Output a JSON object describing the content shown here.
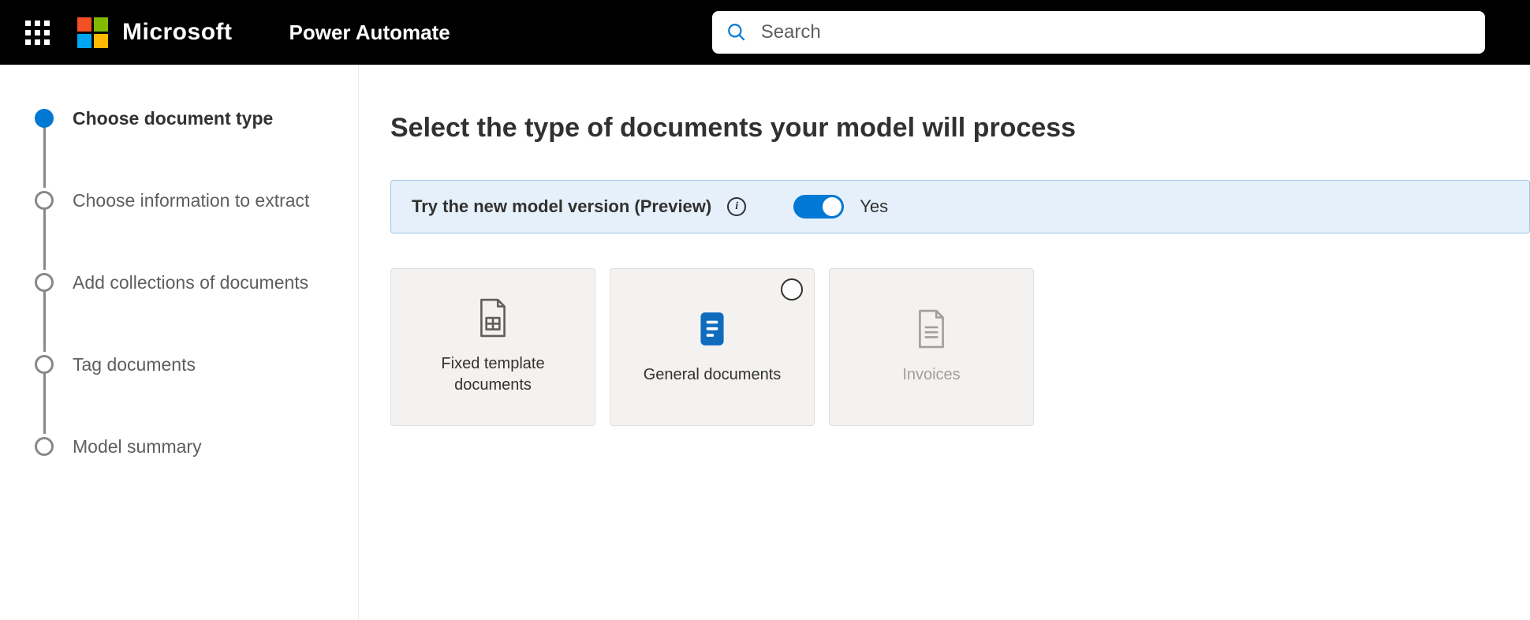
{
  "header": {
    "company": "Microsoft",
    "app": "Power Automate",
    "search_placeholder": "Search"
  },
  "wizard": {
    "steps": [
      {
        "label": "Choose document type",
        "active": true
      },
      {
        "label": "Choose information to extract",
        "active": false
      },
      {
        "label": "Add collections of documents",
        "active": false
      },
      {
        "label": "Tag documents",
        "active": false
      },
      {
        "label": "Model summary",
        "active": false
      }
    ]
  },
  "page": {
    "heading": "Select the type of documents your model will process",
    "banner": {
      "text": "Try the new model version (Preview)",
      "toggle_value": "Yes"
    },
    "cards": [
      {
        "label": "Fixed template documents",
        "icon": "fixed-template",
        "selected": false,
        "showRadio": false
      },
      {
        "label": "General documents",
        "icon": "general",
        "selected": true,
        "showRadio": true
      },
      {
        "label": "Invoices",
        "icon": "invoice",
        "selected": false,
        "showRadio": false
      }
    ]
  }
}
